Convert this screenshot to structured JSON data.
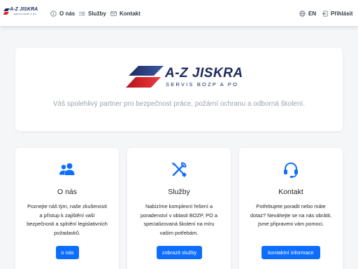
{
  "brand": {
    "title": "A-Z JISKRA",
    "subtitle": "SERVIS BOZP A PO"
  },
  "nav": {
    "items": [
      {
        "label": "O nás",
        "icon": "info-circle-icon"
      },
      {
        "label": "Služby",
        "icon": "list-icon"
      },
      {
        "label": "Kontakt",
        "icon": "envelope-icon"
      }
    ],
    "language_label": "EN",
    "language_icon": "globe-icon",
    "login_label": "Přihlásit",
    "login_icon": "login-icon"
  },
  "hero": {
    "title": "A-Z JISKRA",
    "subtitle": "SERVIS BOZP A PO",
    "tagline": "Váš spolehlivý partner pro bezpečnost práce, požární ochranu a odborná školení."
  },
  "cards": [
    {
      "icon": "people-icon",
      "title": "O nás",
      "lines": [
        "Poznejte náš tým, naše zkušenosti",
        "a přístup k zajištění vaší",
        "bezpečnosti a splnění legislativních",
        "požadavků."
      ],
      "button": "o nás"
    },
    {
      "icon": "tools-icon",
      "title": "Služby",
      "lines": [
        "Nabízíme komplexní řešení a",
        "poradenství v oblasti BOZP, PO a",
        "specializovaná školení na míru",
        "vašim potřebám."
      ],
      "button": "zobrazit služby"
    },
    {
      "icon": "headset-icon",
      "title": "Kontakt",
      "lines": [
        "Potřebujete poradit nebo máte",
        "dotaz? Neváhejte se na nás obrátit,",
        "jsme připraveni vám pomoci."
      ],
      "button": "kontaktní informace"
    }
  ],
  "colors": {
    "accent": "#0d6efd",
    "brand_navy": "#1d2a5c",
    "brand_red": "#e31e24",
    "background": "#f5f6f8"
  }
}
